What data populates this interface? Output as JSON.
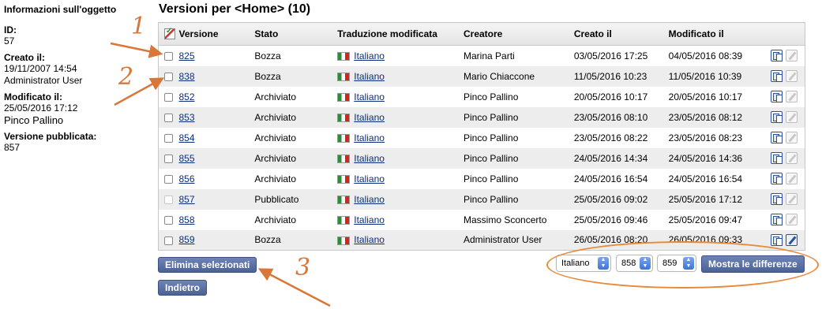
{
  "sidebar": {
    "heading": "Informazioni sull'oggetto",
    "id_label": "ID:",
    "id_value": "57",
    "created_label": "Creato il:",
    "created_date": "19/11/2007 14:54",
    "created_by": "Administrator User",
    "modified_label": "Modificato il:",
    "modified_date": "25/05/2016 17:12",
    "modified_by": "Pinco Pallino",
    "published_label": "Versione pubblicata:",
    "published_value": "857"
  },
  "title": "Versioni per <Home> (10)",
  "table": {
    "headers": {
      "version": "Versione",
      "status": "Stato",
      "translation": "Traduzione modificata",
      "creator": "Creatore",
      "created": "Creato il",
      "modified": "Modificato il"
    },
    "rows": [
      {
        "version": "825",
        "status": "Bozza",
        "translation": "Italiano",
        "creator": "Marina Parti",
        "created": "03/05/2016 17:25",
        "modified": "04/05/2016 08:39"
      },
      {
        "version": "838",
        "status": "Bozza",
        "translation": "Italiano",
        "creator": "Mario Chiaccone",
        "created": "11/05/2016 10:23",
        "modified": "11/05/2016 10:39"
      },
      {
        "version": "852",
        "status": "Archiviato",
        "translation": "Italiano",
        "creator": "Pinco Pallino",
        "created": "20/05/2016 10:17",
        "modified": "20/05/2016 10:17"
      },
      {
        "version": "853",
        "status": "Archiviato",
        "translation": "Italiano",
        "creator": "Pinco Pallino",
        "created": "23/05/2016 08:10",
        "modified": "23/05/2016 08:12"
      },
      {
        "version": "854",
        "status": "Archiviato",
        "translation": "Italiano",
        "creator": "Pinco Pallino",
        "created": "23/05/2016 08:22",
        "modified": "23/05/2016 08:23"
      },
      {
        "version": "855",
        "status": "Archiviato",
        "translation": "Italiano",
        "creator": "Pinco Pallino",
        "created": "24/05/2016 14:34",
        "modified": "24/05/2016 14:36"
      },
      {
        "version": "856",
        "status": "Archiviato",
        "translation": "Italiano",
        "creator": "Pinco Pallino",
        "created": "24/05/2016 16:54",
        "modified": "24/05/2016 16:54"
      },
      {
        "version": "857",
        "status": "Pubblicato",
        "translation": "Italiano",
        "creator": "Pinco Pallino",
        "created": "25/05/2016 09:02",
        "modified": "25/05/2016 17:12"
      },
      {
        "version": "858",
        "status": "Archiviato",
        "translation": "Italiano",
        "creator": "Massimo Sconcerto",
        "created": "25/05/2016 09:46",
        "modified": "25/05/2016 09:47"
      },
      {
        "version": "859",
        "status": "Bozza",
        "translation": "Italiano",
        "creator": "Administrator User",
        "created": "26/05/2016 08:20",
        "modified": "26/05/2016 09:33"
      }
    ]
  },
  "buttons": {
    "delete_selected": "Elimina selezionati",
    "back": "Indietro",
    "show_diff": "Mostra le differenze"
  },
  "diff": {
    "language": "Italiano",
    "version_a": "858",
    "version_b": "859"
  },
  "annotations": {
    "one": "1",
    "two": "2",
    "three": "3",
    "color": "#d9763a"
  },
  "icons": [
    "select-all-icon",
    "flag-italy-icon",
    "copy-version-icon",
    "edit-version-icon"
  ]
}
